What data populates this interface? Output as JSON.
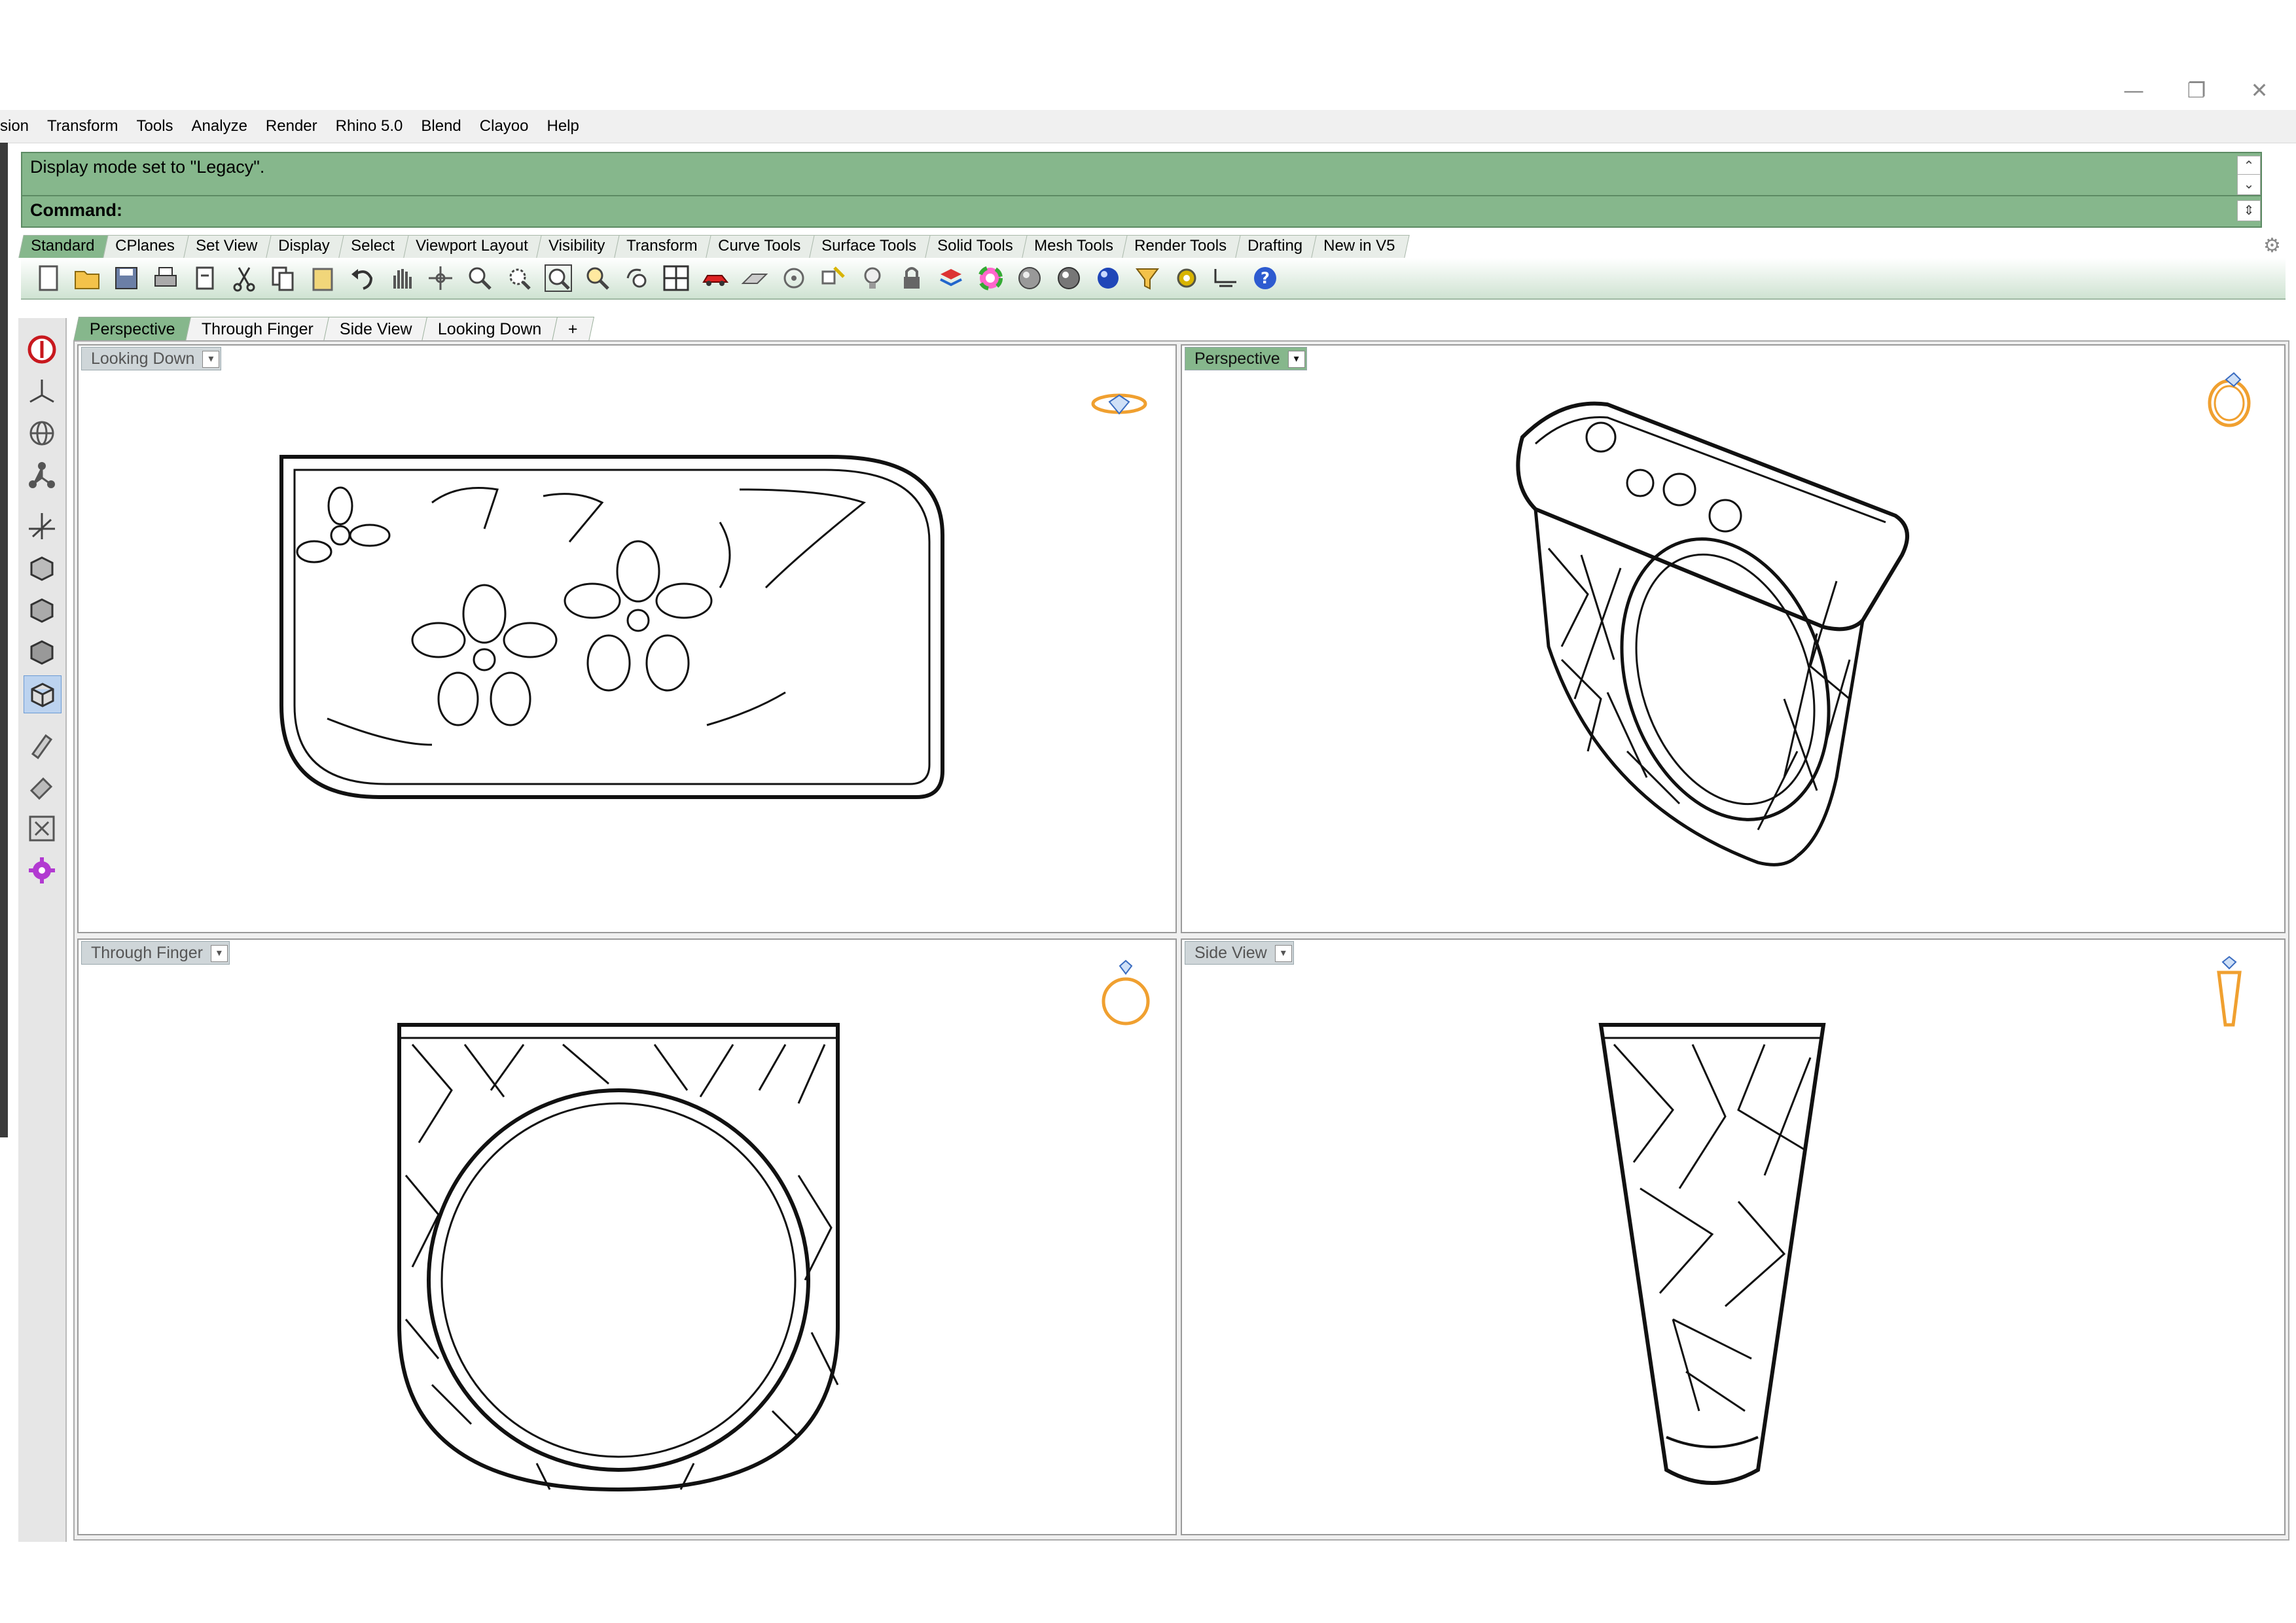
{
  "window": {
    "controls": {
      "minimize": "—",
      "restore": "❐",
      "close": "✕"
    }
  },
  "menu": [
    "sion",
    "Transform",
    "Tools",
    "Analyze",
    "Render",
    "Rhino 5.0",
    "Blend",
    "Clayoo",
    "Help"
  ],
  "command": {
    "history": "Display mode set to \"Legacy\".",
    "prompt_label": "Command:",
    "input_value": ""
  },
  "tool_tabs": [
    {
      "label": "Standard",
      "active": true
    },
    {
      "label": "CPlanes"
    },
    {
      "label": "Set View"
    },
    {
      "label": "Display"
    },
    {
      "label": "Select"
    },
    {
      "label": "Viewport Layout"
    },
    {
      "label": "Visibility"
    },
    {
      "label": "Transform"
    },
    {
      "label": "Curve Tools"
    },
    {
      "label": "Surface Tools"
    },
    {
      "label": "Solid Tools"
    },
    {
      "label": "Mesh Tools"
    },
    {
      "label": "Render Tools"
    },
    {
      "label": "Drafting"
    },
    {
      "label": "New in V5"
    }
  ],
  "toolbar_icons": [
    "new-file-icon",
    "open-folder-icon",
    "save-icon",
    "print-icon",
    "import-icon",
    "cut-icon",
    "copy-icon",
    "paste-icon",
    "undo-icon",
    "pan-hand-icon",
    "rotate-view-icon",
    "zoom-icon",
    "zoom-window-icon",
    "zoom-extents-icon",
    "zoom-selected-icon",
    "undo-view-icon",
    "four-viewports-icon",
    "car-icon",
    "cplane-icon",
    "point-icon",
    "snap-icon",
    "light-bulb-icon",
    "lock-icon",
    "layer-icon",
    "color-wheel-icon",
    "shaded-sphere-icon",
    "rendered-sphere-icon",
    "blue-sphere-icon",
    "filter-icon",
    "options-gear-icon",
    "dimension-icon",
    "help-icon"
  ],
  "viewport_tabs": [
    {
      "label": "Perspective",
      "active": true
    },
    {
      "label": "Through Finger"
    },
    {
      "label": "Side View"
    },
    {
      "label": "Looking Down"
    },
    {
      "label": "+"
    }
  ],
  "viewports": {
    "top_left": {
      "label": "Looking Down",
      "active": false
    },
    "top_right": {
      "label": "Perspective",
      "active": true
    },
    "bottom_left": {
      "label": "Through Finger",
      "active": false
    },
    "bottom_right": {
      "label": "Side View",
      "active": false
    }
  },
  "colors": {
    "command_green": "#86b78c",
    "gumball_gold": "#f0a030"
  }
}
